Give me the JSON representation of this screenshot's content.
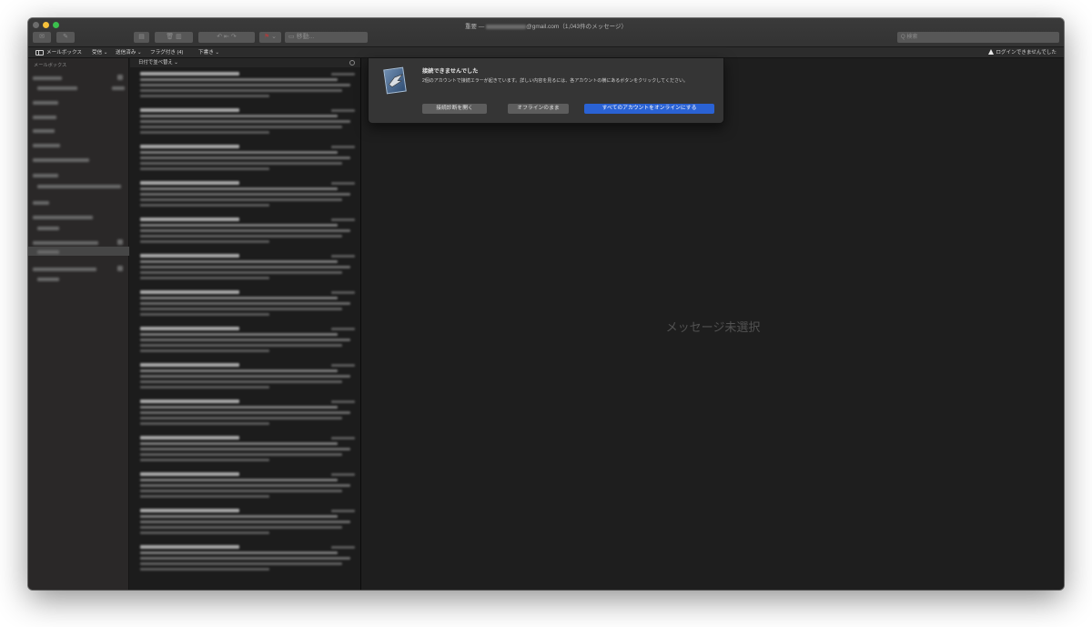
{
  "window": {
    "title_suffix": "@gmail.com（1,043件のメッセージ）",
    "title_prefix": "重要 — "
  },
  "toolbar": {
    "search_placeholder": "Q 検索",
    "move_placeholder": "移動..."
  },
  "favorites": {
    "mailboxes": "メールボックス",
    "inbox": "受信 ⌄",
    "sent": "送信済み ⌄",
    "flagged": "フラグ付き (4)",
    "drafts": "下書き ⌄",
    "login_warning": "ログインできませんでした"
  },
  "sidebar": {
    "header": "メールボックス"
  },
  "message_list": {
    "sort_label": "日付で並べ替え ⌄"
  },
  "alert": {
    "title": "接続できませんでした",
    "body": "2個のアカウントで接続エラーが起きています。詳しい内容を見るには、各アカウントの横にあるボタンをクリックしてください。",
    "btn_diagnose": "接続診断を開く",
    "btn_offline": "オフラインのまま",
    "btn_online": "すべてのアカウントをオンラインにする"
  },
  "viewer": {
    "no_message": "メッセージ未選択"
  },
  "colors": {
    "primary_button": "#2a62d4",
    "window_bg": "#1e1e1e"
  }
}
